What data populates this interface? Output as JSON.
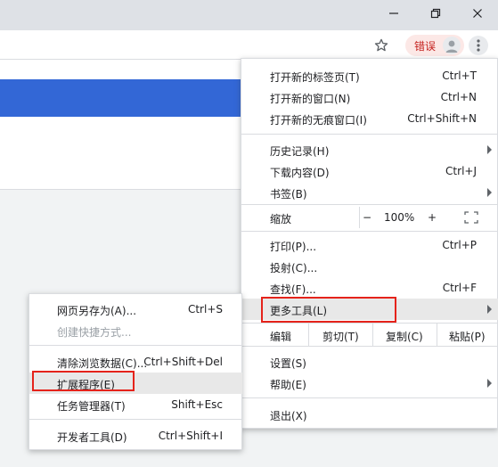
{
  "window": {
    "minimize_icon": "minimize-icon",
    "maximize_icon": "restore-icon",
    "close_icon": "close-icon"
  },
  "toolbar": {
    "bookmark_icon": "star-icon",
    "error_label": "错误",
    "avatar_icon": "avatar-icon",
    "menu_icon": "kebab-menu-icon"
  },
  "main_menu": {
    "new_tab": {
      "label": "打开新的标签页(T)",
      "shortcut": "Ctrl+T"
    },
    "new_window": {
      "label": "打开新的窗口(N)",
      "shortcut": "Ctrl+N"
    },
    "new_incognito": {
      "label": "打开新的无痕窗口(I)",
      "shortcut": "Ctrl+Shift+N"
    },
    "history": {
      "label": "历史记录(H)"
    },
    "downloads": {
      "label": "下载内容(D)",
      "shortcut": "Ctrl+J"
    },
    "bookmarks": {
      "label": "书签(B)"
    },
    "zoom": {
      "label": "缩放",
      "minus": "−",
      "value": "100%",
      "plus": "+"
    },
    "print": {
      "label": "打印(P)...",
      "shortcut": "Ctrl+P"
    },
    "cast": {
      "label": "投射(C)..."
    },
    "find": {
      "label": "查找(F)...",
      "shortcut": "Ctrl+F"
    },
    "more_tools": {
      "label": "更多工具(L)"
    },
    "edit": {
      "label": "编辑",
      "cut": "剪切(T)",
      "copy": "复制(C)",
      "paste": "粘贴(P)"
    },
    "settings": {
      "label": "设置(S)"
    },
    "help": {
      "label": "帮助(E)"
    },
    "exit": {
      "label": "退出(X)"
    }
  },
  "sub_menu": {
    "save_page": {
      "label": "网页另存为(A)...",
      "shortcut": "Ctrl+S"
    },
    "create_shortcut": {
      "label": "创建快捷方式..."
    },
    "clear_data": {
      "label": "清除浏览数据(C)...",
      "shortcut": "Ctrl+Shift+Del"
    },
    "extensions": {
      "label": "扩展程序(E)"
    },
    "task_manager": {
      "label": "任务管理器(T)",
      "shortcut": "Shift+Esc"
    },
    "dev_tools": {
      "label": "开发者工具(D)",
      "shortcut": "Ctrl+Shift+I"
    }
  },
  "colors": {
    "highlight_box": "#e5231b",
    "banner": "#3367d6",
    "error_pill_bg": "#fce8e6",
    "error_text": "#c5221f"
  }
}
